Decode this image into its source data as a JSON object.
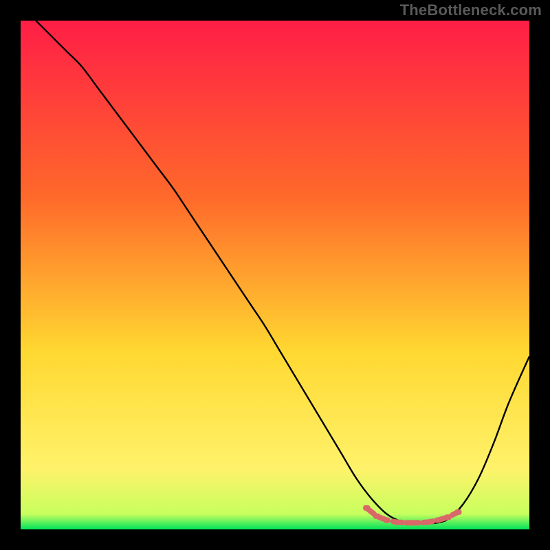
{
  "watermark": "TheBottleneck.com",
  "colors": {
    "background": "#000000",
    "gradient_top": "#ff1e46",
    "gradient_mid1": "#ff6a2a",
    "gradient_mid2": "#ffd831",
    "gradient_mid3": "#fff26a",
    "gradient_bottom": "#00e35a",
    "curve": "#000000",
    "marker": "#d96969",
    "watermark": "#5a5a5a"
  },
  "chart_data": {
    "type": "line",
    "title": "",
    "xlabel": "",
    "ylabel": "",
    "xlim": [
      0,
      100
    ],
    "ylim": [
      0,
      100
    ],
    "grid": false,
    "legend": null,
    "series": [
      {
        "name": "bottleneck-curve",
        "x": [
          3,
          6,
          9,
          12,
          15,
          18,
          21,
          24,
          27,
          30,
          33,
          36,
          39,
          42,
          45,
          48,
          51,
          54,
          57,
          60,
          63,
          66,
          69,
          72,
          75,
          78,
          81,
          84,
          87,
          90,
          93,
          96,
          100
        ],
        "y": [
          100,
          97,
          94,
          91,
          87,
          83,
          79,
          75,
          71,
          67,
          62.5,
          58,
          53.5,
          49,
          44.5,
          40,
          35,
          30,
          25,
          20,
          15,
          10,
          6,
          3,
          1.5,
          1.2,
          1.2,
          2,
          5,
          10,
          17,
          25,
          34
        ]
      }
    ],
    "markers": {
      "name": "optimal-range",
      "x": [
        68,
        70,
        72,
        74,
        76,
        78,
        80,
        82,
        84,
        86
      ],
      "y": [
        4.2,
        2.6,
        1.8,
        1.4,
        1.3,
        1.3,
        1.4,
        1.8,
        2.4,
        3.4
      ]
    },
    "gradient_stops": [
      {
        "offset": 0.0,
        "color": "#ff1e46"
      },
      {
        "offset": 0.35,
        "color": "#ff6a2a"
      },
      {
        "offset": 0.65,
        "color": "#ffd831"
      },
      {
        "offset": 0.88,
        "color": "#fff26a"
      },
      {
        "offset": 0.97,
        "color": "#c7ff5e"
      },
      {
        "offset": 1.0,
        "color": "#00e35a"
      }
    ]
  }
}
